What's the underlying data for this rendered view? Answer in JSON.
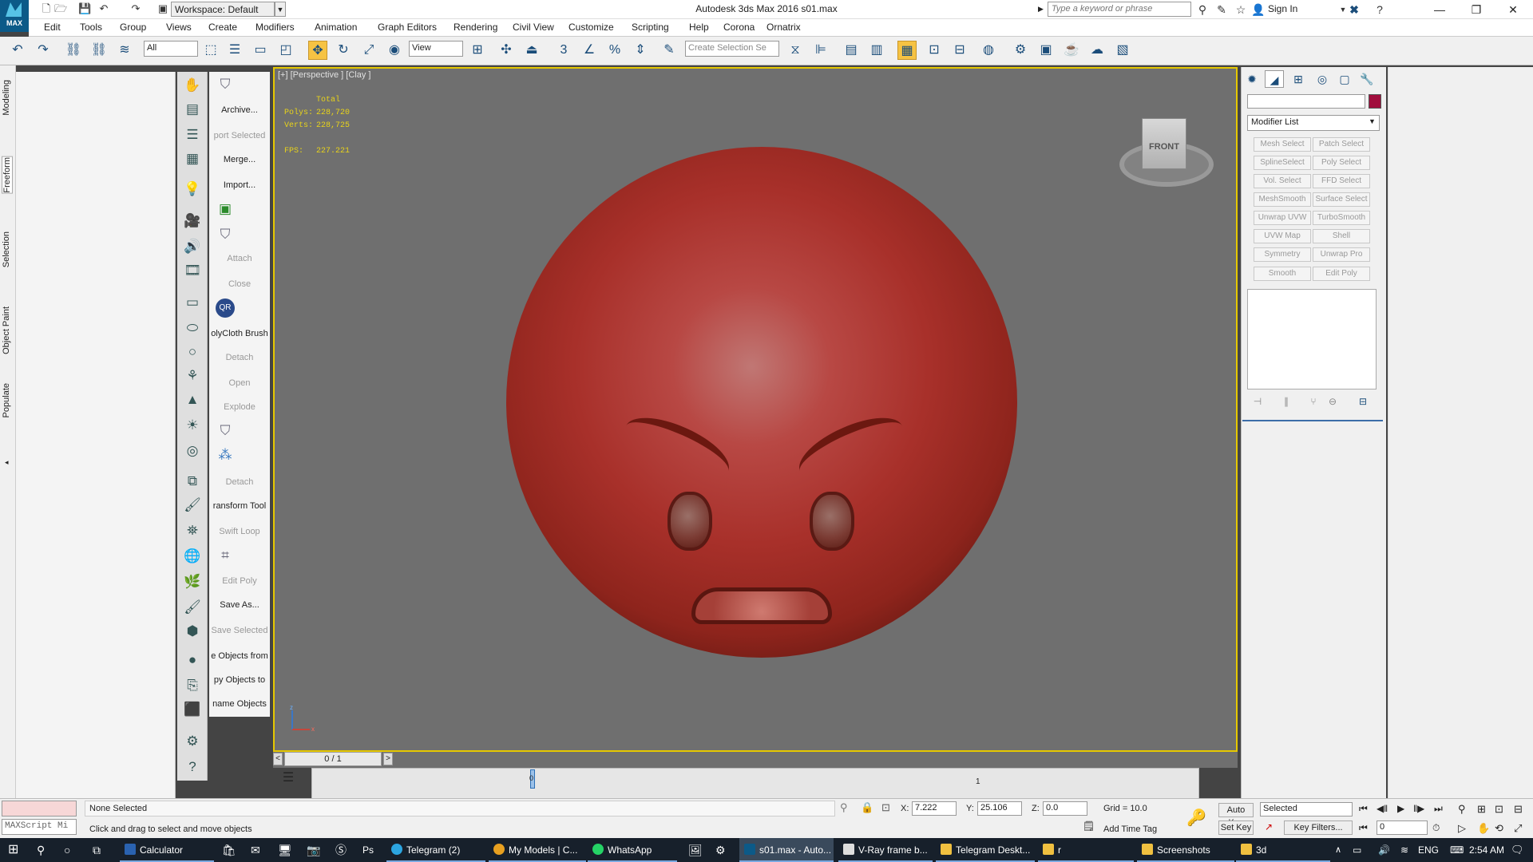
{
  "titlebar": {
    "workspace": "Workspace: Default",
    "title": "Autodesk 3ds Max 2016     s01.max",
    "search_placeholder": "Type a keyword or phrase",
    "sign_in": "Sign In",
    "logo": "MAX"
  },
  "menus": [
    "Edit",
    "Tools",
    "Group",
    "Views",
    "Create",
    "Modifiers",
    "Animation",
    "Graph Editors",
    "Rendering",
    "Civil View",
    "Customize",
    "Scripting",
    "Help",
    "Corona",
    "Ornatrix"
  ],
  "toolbar": {
    "filter": "All",
    "ref_coord": "View",
    "selection_set": "Create Selection Se"
  },
  "ribbon_tabs": [
    "Modeling",
    "Freeform",
    "Selection",
    "Object Paint",
    "Populate"
  ],
  "tool_labels": [
    {
      "text": "Archive...",
      "dim": false
    },
    {
      "text": "port Selected",
      "dim": true
    },
    {
      "text": "Merge...",
      "dim": false
    },
    {
      "text": "Import...",
      "dim": false
    },
    {
      "text": "Attach",
      "dim": true
    },
    {
      "text": "Close",
      "dim": true
    },
    {
      "text": "olyCloth Brush",
      "dim": false
    },
    {
      "text": "Detach",
      "dim": true
    },
    {
      "text": "Open",
      "dim": true
    },
    {
      "text": "Explode",
      "dim": true
    },
    {
      "text": "Detach",
      "dim": true
    },
    {
      "text": "ransform Tool",
      "dim": false
    },
    {
      "text": "Swift Loop",
      "dim": true
    },
    {
      "text": "Edit Poly",
      "dim": true
    },
    {
      "text": "Save As...",
      "dim": false
    },
    {
      "text": "Save Selected",
      "dim": true
    },
    {
      "text": "e Objects from",
      "dim": false
    },
    {
      "text": "py Objects to",
      "dim": false
    },
    {
      "text": "name Objects",
      "dim": false
    }
  ],
  "viewport": {
    "label": "[+] [Perspective ] [Clay ]",
    "stats": {
      "total_label": "Total",
      "polys_label": "Polys:",
      "polys": "228,720",
      "verts_label": "Verts:",
      "verts": "228,725",
      "fps_label": "FPS:",
      "fps": "227.221"
    },
    "viewcube_face": "FRONT",
    "axis_labels": {
      "z": "z",
      "x": "x"
    }
  },
  "timeline": {
    "frame": "0 / 1",
    "prev": "<",
    "next": ">",
    "tick_0": "0",
    "tick_1": "1"
  },
  "command_panel": {
    "modifier_list": "Modifier List",
    "object_color": "#a10e3d",
    "modifiers": [
      "Mesh Select",
      "Patch Select",
      "SplineSelect",
      "Poly Select",
      "Vol. Select",
      "FFD Select",
      "MeshSmooth",
      "Surface Select",
      "Unwrap UVW",
      "TurboSmooth",
      "UVW Map",
      "Shell",
      "Symmetry",
      "Unwrap Pro",
      "Smooth",
      "Edit Poly"
    ]
  },
  "status": {
    "maxscript": "MAXScript Mi",
    "selection": "None Selected",
    "prompt": "Click and drag to select and move objects",
    "x_label": "X:",
    "x": "7.222",
    "y_label": "Y:",
    "y": "25.106",
    "z_label": "Z:",
    "z": "0.0",
    "grid": "Grid = 10.0",
    "add_time_tag": "Add Time Tag",
    "auto_key": "Auto Key",
    "set_key": "Set Key",
    "selected": "Selected",
    "key_filters": "Key Filters...",
    "frame_value": "0"
  },
  "taskbar": {
    "items": [
      "Calculator",
      "Telegram (2)",
      "My Models | C...",
      "WhatsApp",
      "s01.max - Auto...",
      "V-Ray frame b...",
      "Telegram Deskt...",
      "r",
      "Screenshots",
      "3d"
    ],
    "lang": "ENG",
    "time": "2:54 AM"
  }
}
